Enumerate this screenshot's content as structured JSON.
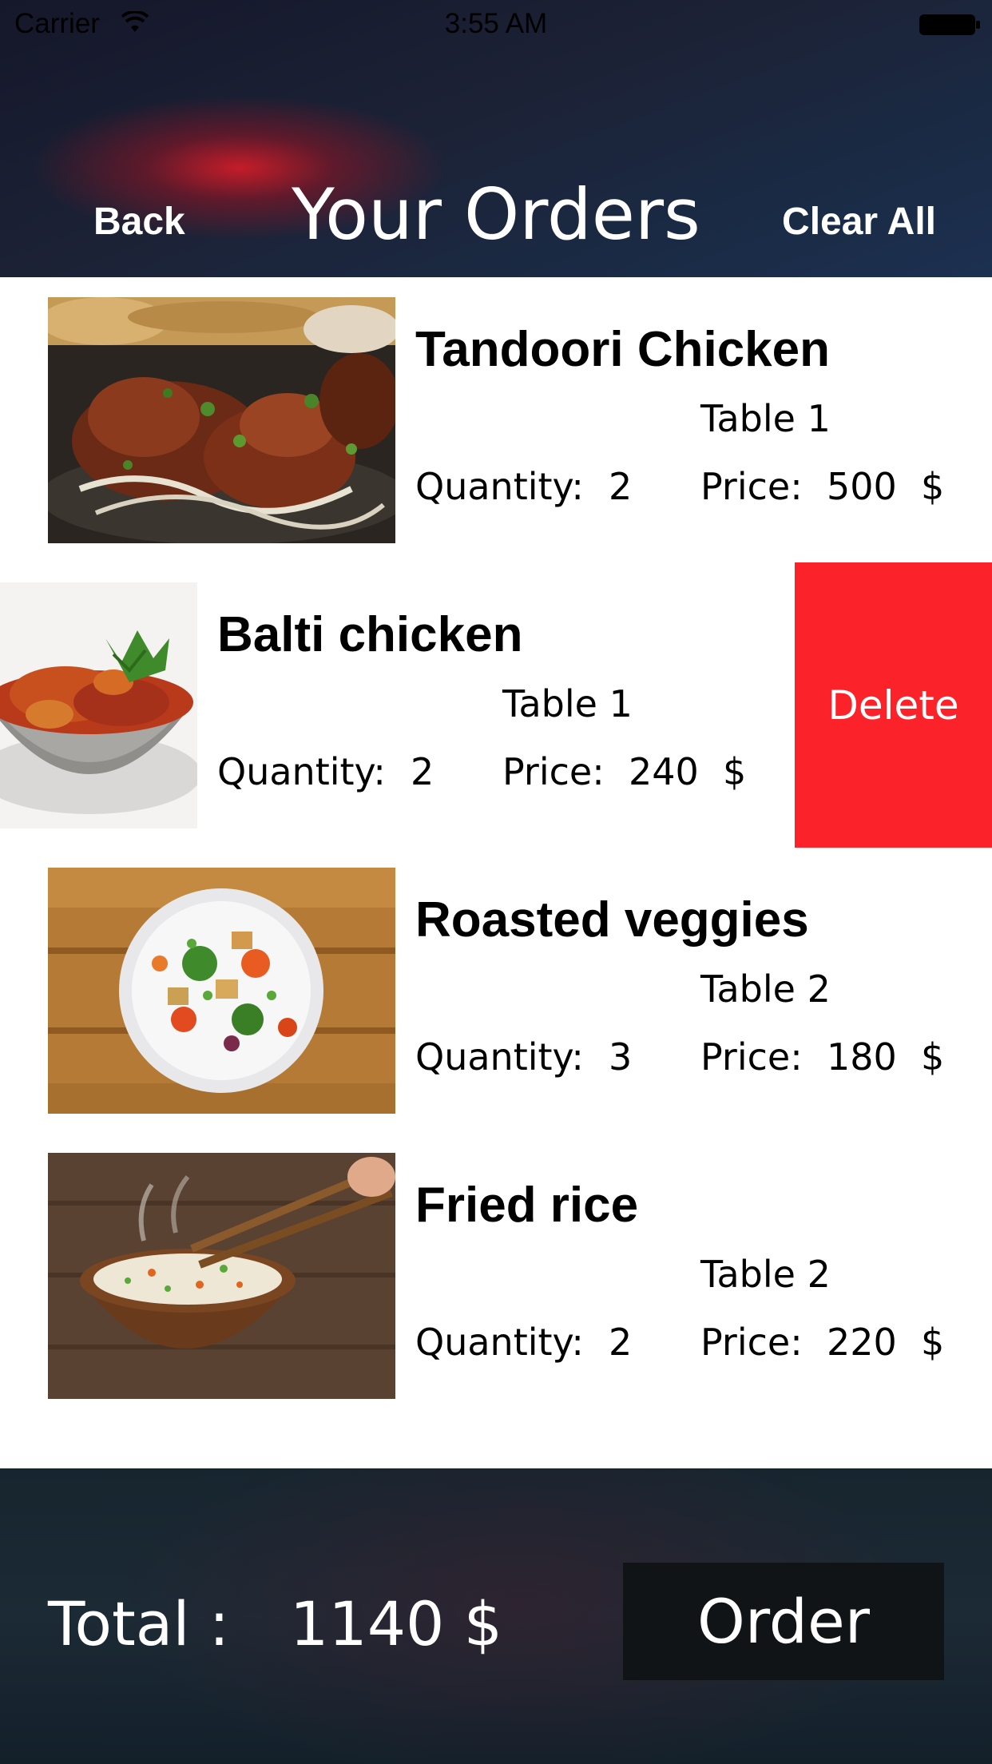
{
  "status_bar": {
    "carrier": "Carrier",
    "time": "3:55 AM",
    "wifi_icon": "wifi-icon",
    "battery_icon": "battery-icon"
  },
  "header": {
    "back_label": "Back",
    "title": "Your Orders",
    "clear_all_label": "Clear All"
  },
  "orders": [
    {
      "name": "Tandoori Chicken",
      "table": "Table 1",
      "quantity_label": "Quantity:",
      "quantity": "2",
      "price_label": "Price:",
      "price": "500",
      "currency": "$",
      "image": "tandoori-chicken-photo"
    },
    {
      "name": "Balti chicken",
      "table": "Table 1",
      "quantity_label": "Quantity:",
      "quantity": "2",
      "price_label": "Price:",
      "price": "240",
      "currency": "$",
      "image": "balti-chicken-photo",
      "delete_label": "Delete"
    },
    {
      "name": "Roasted veggies",
      "table": "Table 2",
      "quantity_label": "Quantity:",
      "quantity": "3",
      "price_label": "Price:",
      "price": "180",
      "currency": "$",
      "image": "roasted-veggies-photo"
    },
    {
      "name": "Fried rice",
      "table": "Table 2",
      "quantity_label": "Quantity:",
      "quantity": "2",
      "price_label": "Price:",
      "price": "220",
      "currency": "$",
      "image": "fried-rice-photo"
    }
  ],
  "footer": {
    "total_label": "Total :",
    "total_value": "1140 $",
    "order_label": "Order"
  },
  "colors": {
    "delete": "#fc2229",
    "order_button": "#111416"
  }
}
